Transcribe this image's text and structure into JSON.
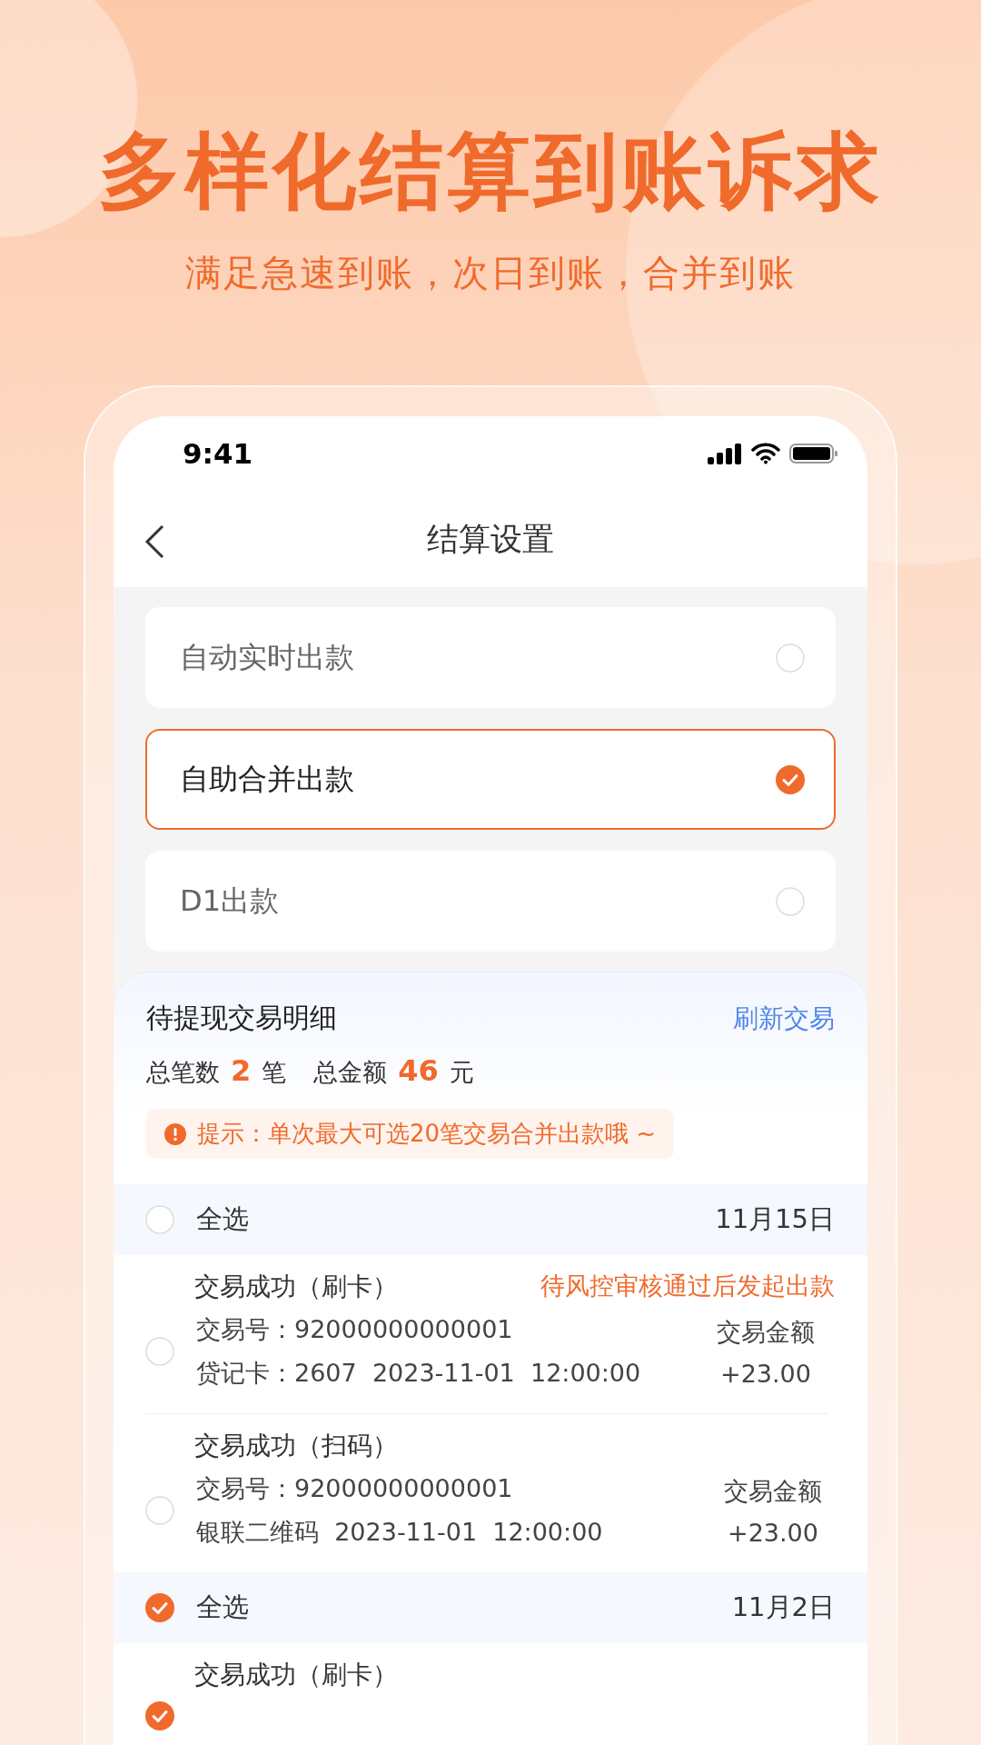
{
  "headline": "多样化结算到账诉求",
  "subheadline": "满足急速到账，次日到账，合并到账",
  "status_bar": {
    "time": "9:41"
  },
  "nav": {
    "title": "结算设置"
  },
  "options": [
    {
      "label": "自动实时出款",
      "selected": false
    },
    {
      "label": "自助合并出款",
      "selected": true
    },
    {
      "label": "D1出款",
      "selected": false
    }
  ],
  "details": {
    "title": "待提现交易明细",
    "refresh": "刷新交易",
    "count_label": "总笔数",
    "count": "2",
    "count_unit": "笔",
    "amount_label": "总金额",
    "amount": "46",
    "amount_unit": "元",
    "tip": "提示：单次最大可选20笔交易合并出款哦 ~"
  },
  "groups": [
    {
      "select_all": "全选",
      "date": "11月15日",
      "selected": false,
      "transactions": [
        {
          "title": "交易成功（刷卡）",
          "status": "待风控审核通过后发起出款",
          "selected": false,
          "id_line": "交易号：92000000000001",
          "info_line": "贷记卡：2607  2023-11-01  12:00:00",
          "amount_label": "交易金额",
          "amount": "+23.00"
        },
        {
          "title": "交易成功（扫码）",
          "selected": false,
          "id_line": "交易号：92000000000001",
          "info_line": "银联二维码  2023-11-01  12:00:00",
          "amount_label": "交易金额",
          "amount": "+23.00"
        }
      ]
    },
    {
      "select_all": "全选",
      "date": "11月2日",
      "selected": true,
      "transactions": [
        {
          "title": "交易成功（刷卡）",
          "selected": true
        }
      ]
    }
  ]
}
